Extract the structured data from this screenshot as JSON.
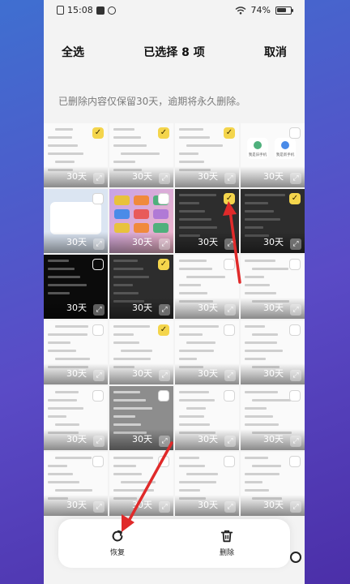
{
  "status_bar": {
    "time": "15:08",
    "battery": "74%",
    "battery_fraction": 0.74
  },
  "header": {
    "select_all": "全选",
    "title": "已选择 8 项",
    "cancel": "取消"
  },
  "notice": "已删除内容仅保留30天，逾期将永久删除。",
  "grid": {
    "tiles": [
      {
        "theme": "light",
        "selected": true,
        "days": "30天"
      },
      {
        "theme": "light",
        "selected": true,
        "days": "30天"
      },
      {
        "theme": "light",
        "selected": true,
        "days": "30天"
      },
      {
        "theme": "light",
        "selected": false,
        "days": "30天",
        "labels": [
          "我是旧手机",
          "我是新手机"
        ]
      },
      {
        "theme": "blue",
        "selected": false,
        "days": "30天"
      },
      {
        "theme": "colorful",
        "selected": false,
        "days": "30天"
      },
      {
        "theme": "dark",
        "selected": true,
        "days": "30天"
      },
      {
        "theme": "dark",
        "selected": true,
        "days": "30天"
      },
      {
        "theme": "black",
        "selected": false,
        "days": "30天"
      },
      {
        "theme": "dark",
        "selected": true,
        "days": "30天"
      },
      {
        "theme": "light",
        "selected": false,
        "days": "30天"
      },
      {
        "theme": "light",
        "selected": false,
        "days": "30天"
      },
      {
        "theme": "light",
        "selected": false,
        "days": "30天"
      },
      {
        "theme": "light",
        "selected": true,
        "days": "30天"
      },
      {
        "theme": "light",
        "selected": false,
        "days": "30天"
      },
      {
        "theme": "light",
        "selected": false,
        "days": "30天"
      },
      {
        "theme": "light",
        "selected": false,
        "days": "30天"
      },
      {
        "theme": "gray",
        "selected": false,
        "days": "30天"
      },
      {
        "theme": "light",
        "selected": false,
        "days": "30天"
      },
      {
        "theme": "light",
        "selected": false,
        "days": "30天"
      },
      {
        "theme": "light",
        "selected": false,
        "days": "30天"
      },
      {
        "theme": "light",
        "selected": false,
        "days": "30天"
      },
      {
        "theme": "light",
        "selected": false,
        "days": "30天"
      },
      {
        "theme": "light",
        "selected": false,
        "days": "30天"
      }
    ]
  },
  "actions": {
    "restore": "恢复",
    "delete": "删除"
  },
  "colors": {
    "check_yellow": "#f4d54c",
    "arrow_red": "#e02a2a"
  }
}
